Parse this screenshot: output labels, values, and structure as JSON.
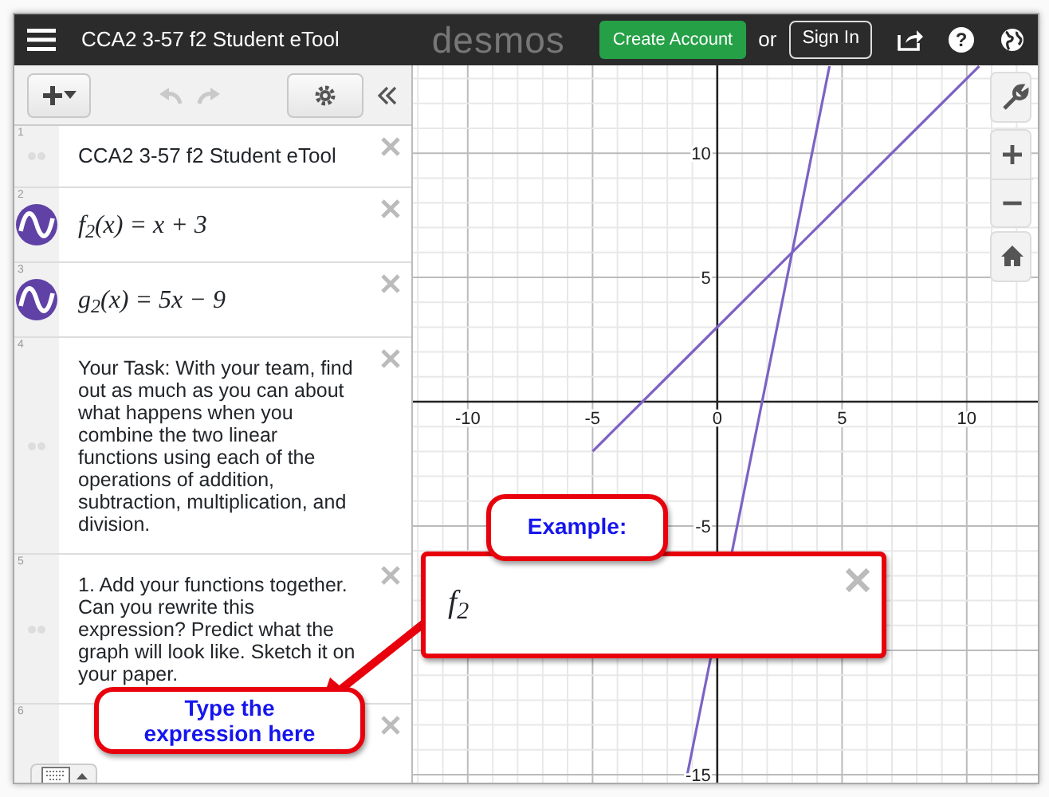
{
  "top_bar": {
    "title": "CCA2 3-57 f2 Student eTool",
    "logo": "desmos",
    "create_account": "Create Account",
    "or": "or",
    "sign_in": "Sign In",
    "help": "?"
  },
  "toolbar": {
    "undo_disabled": true,
    "redo_disabled": true
  },
  "expressions": [
    {
      "number": "1",
      "kind": "note",
      "text": "CCA2 3-57 f2 Student eTool"
    },
    {
      "number": "2",
      "kind": "expression",
      "text": "f$_{2}$(x) = x + 3",
      "color": "#6042a6"
    },
    {
      "number": "3",
      "kind": "expression",
      "text": "g$_{2}$(x) = 5x − 9",
      "color": "#6042a6"
    },
    {
      "number": "4",
      "kind": "note",
      "text": "Your Task: With your team, find out as much as you can about what happens when you combine the two linear functions using each of the operations of addition, subtraction, multiplication, and division."
    },
    {
      "number": "5",
      "kind": "note",
      "text": "1. Add your functions together. Can you rewrite this expression? Predict what the graph will look like. Sketch it on your paper."
    },
    {
      "number": "6",
      "kind": "empty"
    }
  ],
  "graph": {
    "chart_data": {
      "type": "line",
      "grid": true,
      "x": [
        -5,
        -1.2,
        4.5,
        10.5
      ],
      "series": [
        {
          "color": "#7c62c4",
          "values": [
            -2,
            1.8,
            7.5,
            13.5
          ]
        },
        {
          "color": "#7c62c4",
          "values": [
            null,
            -15,
            13.5,
            null
          ]
        }
      ],
      "xlim": [
        -12.2,
        12.85
      ],
      "ylim": [
        -15.45,
        13.53
      ],
      "xticks": [
        -10,
        -5,
        0,
        5,
        10
      ],
      "yticks": [
        -15,
        -5,
        5,
        10
      ]
    }
  },
  "example_box": {
    "text": "f$_{2}$"
  },
  "callouts": [
    {
      "kind": "example",
      "text": "Example:"
    },
    {
      "kind": "hint",
      "text": "Type the expression here"
    }
  ]
}
